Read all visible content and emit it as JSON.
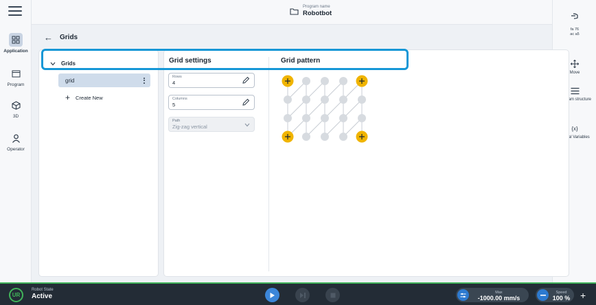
{
  "header": {
    "program_caption": "Program name",
    "program_name": "Robotbot"
  },
  "leftnav": {
    "items": [
      {
        "label": "Application",
        "icon": "grid-apps-icon",
        "active": true
      },
      {
        "label": "Program",
        "icon": "program-window-icon"
      },
      {
        "label": "3D",
        "icon": "cube-icon"
      },
      {
        "label": "Operator",
        "icon": "person-icon"
      }
    ]
  },
  "rightnav": {
    "id_text": "fa 76\nac a5",
    "items": [
      {
        "label": "Move",
        "icon": "move-arrows-icon"
      },
      {
        "label": "Program structure",
        "icon": "list-icon"
      },
      {
        "label": "Global Variables",
        "icon": "variables-icon",
        "glyph": "{x}"
      }
    ]
  },
  "page": {
    "title": "Grids"
  },
  "tree": {
    "header": "Grids",
    "item": "grid",
    "create_new": "Create New"
  },
  "grid_settings": {
    "title": "Grid settings",
    "rows_label": "Rows",
    "rows_value": "4",
    "columns_label": "Columns",
    "columns_value": "5",
    "path_label": "Path",
    "path_value": "Zig-zag vertical"
  },
  "grid_pattern": {
    "title": "Grid pattern",
    "rows": 4,
    "columns": 5,
    "corner_color": "#f0b400",
    "point_color": "#d7dbe0"
  },
  "bottombar": {
    "logo_text": "UR",
    "state_caption": "Robot State",
    "state_value": "Active",
    "max_caption": "Max",
    "max_value": "-1000.00 mm/s",
    "speed_caption": "Speed",
    "speed_value": "100 %",
    "accent": "#41b45a"
  }
}
